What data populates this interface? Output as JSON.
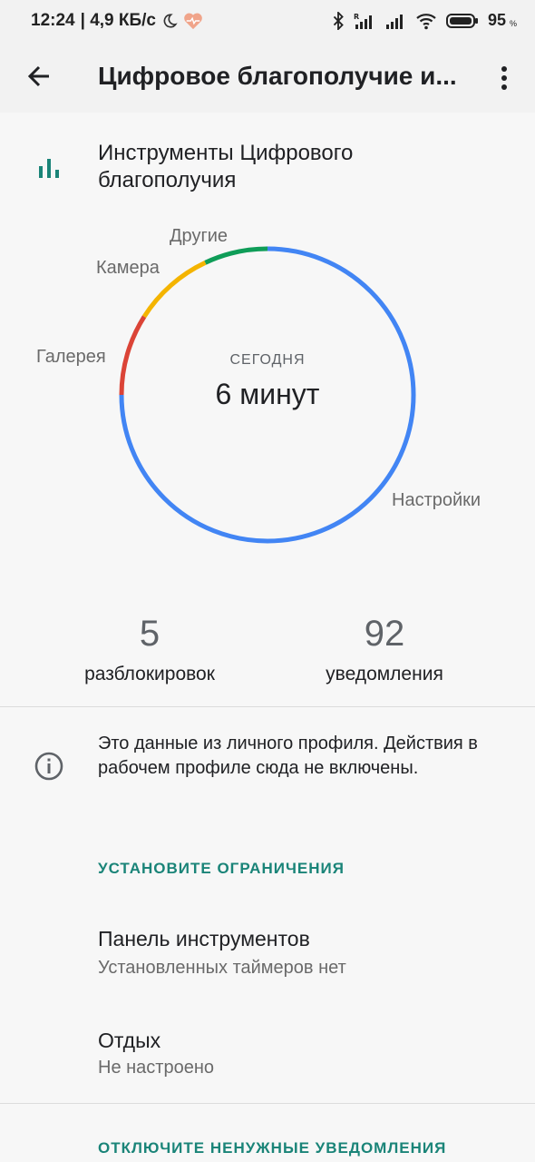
{
  "status_bar": {
    "time": "12:24",
    "network_speed": "| 4,9 КБ/с",
    "battery": "95",
    "battery_unit": "%",
    "icons": [
      "moon-icon",
      "heart-icon",
      "bluetooth-icon",
      "signal-roaming-icon",
      "signal-icon",
      "wifi-icon",
      "battery-icon"
    ]
  },
  "app_bar": {
    "title": "Цифровое благополучие и..."
  },
  "header": {
    "text": "Инструменты Цифрового благополучия"
  },
  "chart_data": {
    "type": "pie",
    "center_caption": "СЕГОДНЯ",
    "center_value": "6 минут",
    "labels": [
      "Настройки",
      "Галерея",
      "Камера",
      "Другие"
    ],
    "values": [
      0.75,
      0.09,
      0.09,
      0.07
    ],
    "colors": [
      "#4285f4",
      "#db4437",
      "#f4b400",
      "#0f9d58"
    ]
  },
  "stats": {
    "unlocks_value": "5",
    "unlocks_label": "разблокировок",
    "notifications_value": "92",
    "notifications_label": "уведомления"
  },
  "info": {
    "text": "Это данные из личного профиля. Действия в рабочем профиле сюда не включены."
  },
  "limits": {
    "heading": "УСТАНОВИТЕ ОГРАНИЧЕНИЯ",
    "dashboard_title": "Панель инструментов",
    "dashboard_subtitle": "Установленных таймеров нет",
    "rest_title": "Отдых",
    "rest_subtitle": "Не настроено"
  },
  "notifications_section": {
    "heading": "ОТКЛЮЧИТЕ НЕНУЖНЫЕ УВЕДОМЛЕНИЯ"
  }
}
